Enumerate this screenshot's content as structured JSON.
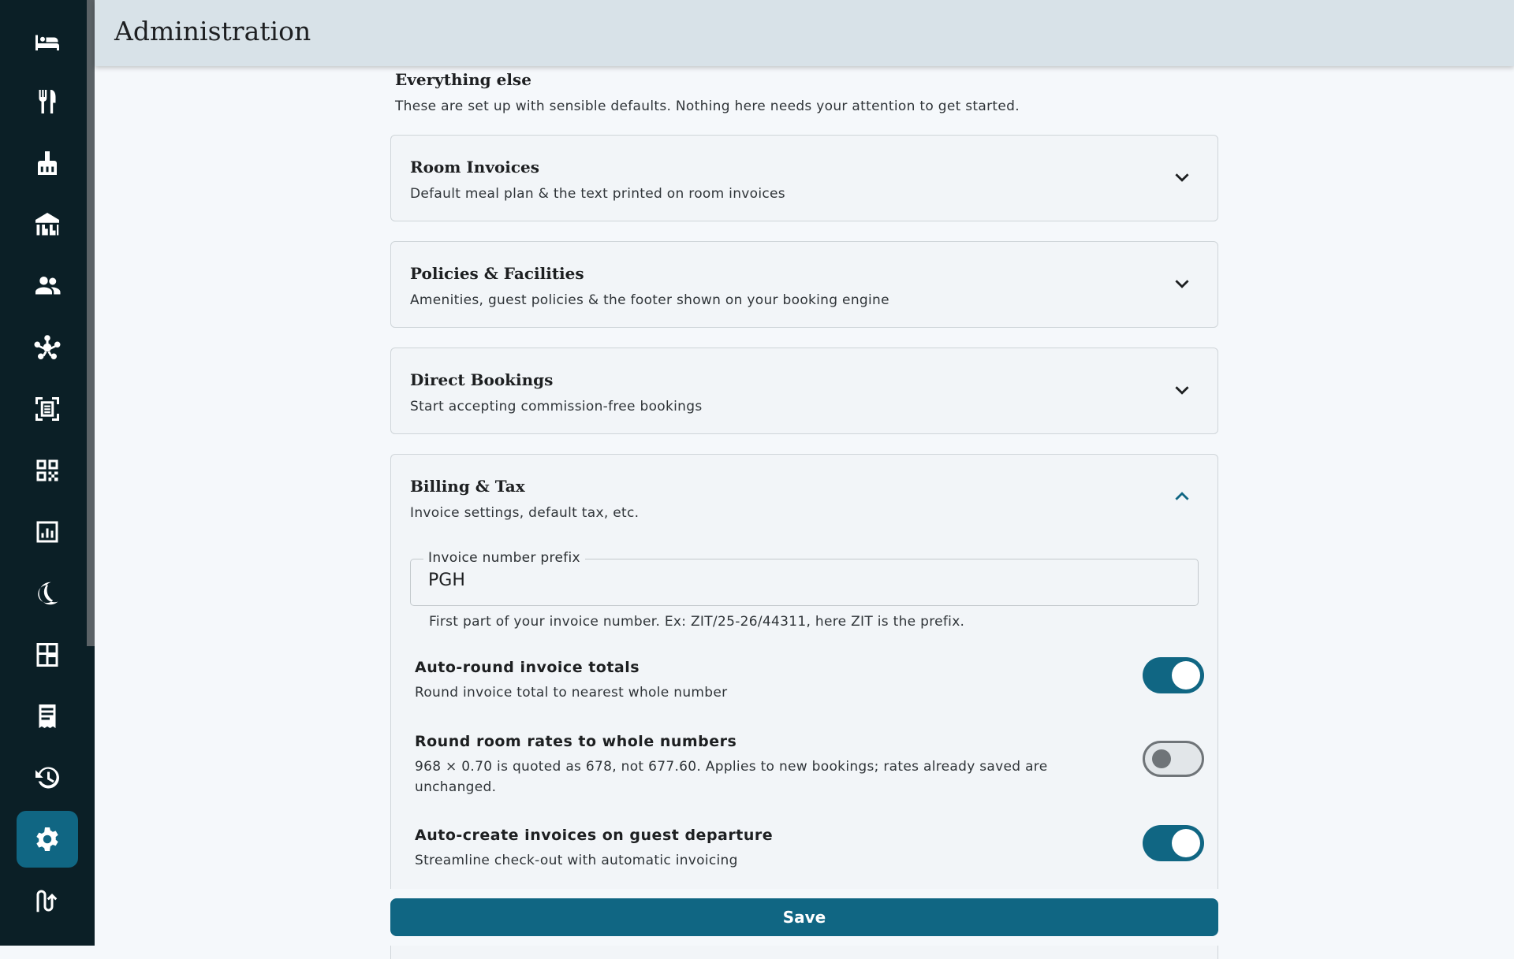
{
  "header": {
    "title": "Administration"
  },
  "sidebar": {
    "items": [
      {
        "icon": "bed-icon",
        "active": false
      },
      {
        "icon": "fork-knife-icon",
        "active": false
      },
      {
        "icon": "broom-icon",
        "active": false
      },
      {
        "icon": "building-icon",
        "active": false
      },
      {
        "icon": "people-icon",
        "active": false
      },
      {
        "icon": "network-hub-icon",
        "active": false
      },
      {
        "icon": "scan-document-icon",
        "active": false
      },
      {
        "icon": "qr-code-icon",
        "active": false
      },
      {
        "icon": "report-chart-icon",
        "active": false
      },
      {
        "icon": "moon-icon",
        "active": false
      },
      {
        "icon": "floor-plan-icon",
        "active": false
      },
      {
        "icon": "receipt-icon",
        "active": false
      },
      {
        "icon": "history-icon",
        "active": false
      },
      {
        "icon": "gear-icon",
        "active": true
      },
      {
        "icon": "route-icon",
        "active": false
      }
    ]
  },
  "section": {
    "title": "Everything else",
    "subtitle": "These are set up with sensible defaults. Nothing here needs your attention to get started."
  },
  "cards": [
    {
      "title": "Room Invoices",
      "description": "Default meal plan & the text printed on room invoices",
      "expanded": false
    },
    {
      "title": "Policies & Facilities",
      "description": "Amenities, guest policies & the footer shown on your booking engine",
      "expanded": false
    },
    {
      "title": "Direct Bookings",
      "description": "Start accepting commission-free bookings",
      "expanded": false
    },
    {
      "title": "Billing & Tax",
      "description": "Invoice settings, default tax, etc.",
      "expanded": true
    }
  ],
  "billing": {
    "prefix_label": "Invoice number prefix",
    "prefix_value": "PGH",
    "prefix_help": "First part of your invoice number. Ex: ZIT/25-26/44311, here ZIT is the prefix.",
    "options": [
      {
        "title": "Auto-round invoice totals",
        "description": "Round invoice total to nearest whole number",
        "enabled": true
      },
      {
        "title": "Round room rates to whole numbers",
        "description": "968 × 0.70 is quoted as 678, not 677.60. Applies to new bookings; rates already saved are unchanged.",
        "enabled": false
      },
      {
        "title": "Auto-create invoices on guest departure",
        "description": "Streamline check-out with automatic invoicing",
        "enabled": true
      }
    ]
  },
  "actions": {
    "save_label": "Save"
  },
  "colors": {
    "sidebar_bg": "#0b1f26",
    "accent": "#106683",
    "header_bg": "#d8e2e8",
    "page_bg": "#f5f8fb"
  }
}
